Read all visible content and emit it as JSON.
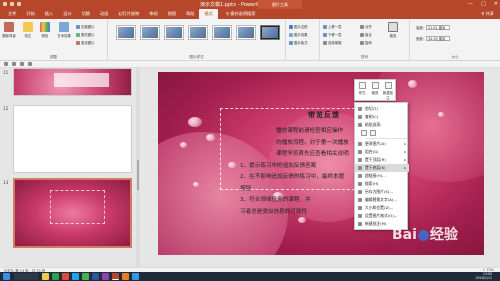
{
  "titlebar": {
    "title": "演示文稿1.pptx - PowerPoint",
    "context_tab": "图片工具",
    "window_buttons": [
      "—",
      "□",
      "✕"
    ]
  },
  "tabs": {
    "items": [
      "文件",
      "开始",
      "插入",
      "设计",
      "切换",
      "动画",
      "幻灯片放映",
      "审阅",
      "视图",
      "帮助",
      "格式"
    ],
    "active": "格式",
    "tellme": "♀ 操作说明搜索",
    "share": "♀ 共享"
  },
  "ribbon": {
    "adjust": {
      "label": "调整",
      "remove_bg": "删除背景",
      "corrections": "校正",
      "color": "颜色",
      "artistic": "艺术效果",
      "compress": "压缩图片",
      "change": "更改图片",
      "reset": "重设图片"
    },
    "styles": {
      "label": "图片样式"
    },
    "style_opts": {
      "border": "图片边框",
      "effects": "图片效果",
      "layout": "图片版式"
    },
    "arrange": {
      "label": "排列",
      "bring_forward": "上移一层",
      "send_backward": "下移一层",
      "selection_pane": "选择窗格",
      "align": "对齐",
      "group": "组合",
      "rotate": "旋转"
    },
    "crop": "裁剪",
    "size": {
      "label": "大小",
      "height_label": "高度:",
      "height": "21.61 厘米",
      "width_label": "宽度:",
      "width": "34.56 厘米"
    }
  },
  "thumbs": {
    "num11": "11",
    "num12": "12",
    "num13": "13"
  },
  "slide": {
    "title": "带览反馈",
    "lines": [
      "播放课程前请检查相应操作",
      "的播放流程。对于第一次播放",
      "课程学员首先应查看相关说明",
      "1、提示练习中的追加反馈答案",
      "2、在不影响追加反馈的练习中，最终本题",
      "按钮",
      "3、符合领域任务的课程，并",
      "习者总是类似信息的可能性"
    ]
  },
  "minitoolbar": {
    "style": "样式",
    "crop": "裁剪",
    "new_comment": "新建批注"
  },
  "context_menu": {
    "items": [
      {
        "label": "剪切(T)"
      },
      {
        "label": "复制(C)"
      },
      {
        "label": "粘贴选项:"
      },
      {
        "label": ""
      },
      {
        "label": "更改图片(A)",
        "arrow": "▸"
      },
      {
        "label": "组合(G)",
        "arrow": "▸"
      },
      {
        "label": "置于顶层(R)",
        "arrow": "▸"
      },
      {
        "label": "置于底层(K)",
        "arrow": "▸"
      },
      {
        "label": "超链接(H)..."
      },
      {
        "label": "搜索(H)"
      },
      {
        "label": "另存为图片(S)..."
      },
      {
        "label": "编辑替换文字(A)..."
      },
      {
        "label": "大小和位置(Z)..."
      },
      {
        "label": "设置图片格式(O)..."
      },
      {
        "label": "新建批注(M)"
      }
    ]
  },
  "statusbar": {
    "left": "幻灯片 第 13 张，共 13 张",
    "right": "+ 72%"
  },
  "taskbar": {
    "time": "13:05",
    "date": "2020/1/11"
  },
  "watermark": {
    "brand_left": "Bai",
    "brand_right": "经验"
  },
  "colors": {
    "accent": "#b7472a",
    "slide_pink": "#c93a6a",
    "taskbar": "#1f2a3a"
  }
}
